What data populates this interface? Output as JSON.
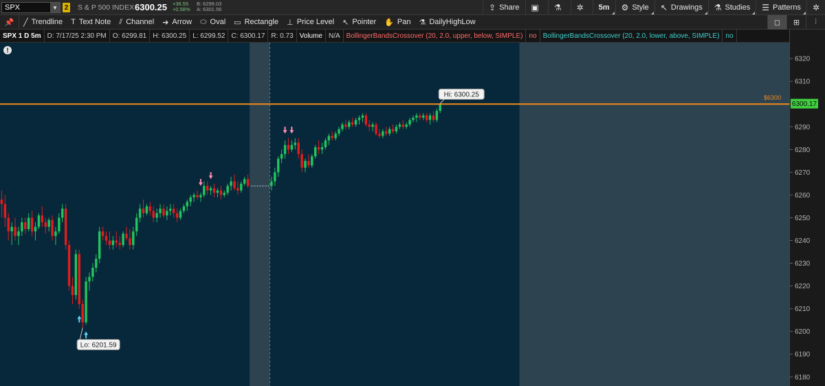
{
  "header": {
    "symbol": "SPX",
    "link_badge": "2",
    "index_name": "S & P 500 INDEX",
    "last_price": "6300.25",
    "change": "+36.55",
    "change_pct": "+0.58%",
    "bid": "B: 6299.03",
    "ask": "A: 6301.56",
    "buttons": {
      "share": "Share",
      "timeframe": "5m",
      "style": "Style",
      "drawings": "Drawings",
      "studies": "Studies",
      "patterns": "Patterns"
    }
  },
  "drawing_tools": [
    {
      "label": "Trendline",
      "icon": "trendline-icon",
      "glyph": "╱"
    },
    {
      "label": "Text Note",
      "icon": "text-note-icon",
      "glyph": "T"
    },
    {
      "label": "Channel",
      "icon": "channel-icon",
      "glyph": "⫽"
    },
    {
      "label": "Arrow",
      "icon": "arrow-icon",
      "glyph": "➜"
    },
    {
      "label": "Oval",
      "icon": "oval-icon",
      "glyph": "⬭"
    },
    {
      "label": "Rectangle",
      "icon": "rectangle-icon",
      "glyph": "▭"
    },
    {
      "label": "Price Level",
      "icon": "price-level-icon",
      "glyph": "⊥"
    },
    {
      "label": "Pointer",
      "icon": "pointer-icon",
      "glyph": "↖"
    },
    {
      "label": "Pan",
      "icon": "pan-icon",
      "glyph": "✋"
    },
    {
      "label": "DailyHighLow",
      "icon": "flask-icon",
      "glyph": "⚗"
    }
  ],
  "info_bar": {
    "title": "SPX 1 D 5m",
    "date": "D: 7/17/25 2:30 PM",
    "open": "O: 6299.81",
    "high": "H: 6300.25",
    "low": "L: 6299.52",
    "close": "C: 6300.17",
    "range": "R: 0.73",
    "volume_label": "Volume",
    "volume_value": "N/A",
    "study1": "BollingerBandsCrossover (20, 2.0, upper, below, SIMPLE)",
    "study1_value": "no",
    "study2": "BollingerBandsCrossover (20, 2.0, lower, above, SIMPLE)",
    "study2_value": "no"
  },
  "colors": {
    "up": "#22c55e",
    "down": "#e21d1d",
    "price_line": "#f28a1a",
    "background_main": "#07273a",
    "background_extended": "#2d4350",
    "current_price_tag": "#3fcf3f",
    "buy_signal": "#5ad2f0",
    "sell_signal": "#ff8fb0"
  },
  "chart_data": {
    "type": "candlestick",
    "symbol": "SPX",
    "interval": "5m",
    "ylim": [
      6176,
      6327
    ],
    "y_ticks": [
      6180,
      6190,
      6200,
      6210,
      6220,
      6230,
      6240,
      6250,
      6260,
      6270,
      6280,
      6290,
      6300,
      6310,
      6320
    ],
    "price_line": {
      "value": 6300,
      "label": "$6300"
    },
    "current_price": "6300.17",
    "high_marker": {
      "label": "Hi: 6300.25",
      "value": 6300.25
    },
    "low_marker": {
      "label": "Lo: 6201.59",
      "value": 6201.59
    },
    "sessions": [
      {
        "name": "regular",
        "start_bar": 0,
        "end_bar": 74
      },
      {
        "name": "extended",
        "start_bar": 74,
        "end_bar": 80
      },
      {
        "name": "regular",
        "start_bar": 80,
        "end_bar": 154
      },
      {
        "name": "extended",
        "start_bar": 154,
        "end_bar": 234
      }
    ],
    "day_separator_bar": 80,
    "total_bars": 234,
    "candles": [
      [
        0,
        6258,
        6262,
        6250,
        6256
      ],
      [
        1,
        6256,
        6260,
        6246,
        6250
      ],
      [
        2,
        6250,
        6252,
        6240,
        6244
      ],
      [
        3,
        6244,
        6248,
        6238,
        6246
      ],
      [
        4,
        6246,
        6250,
        6240,
        6242
      ],
      [
        5,
        6242,
        6246,
        6238,
        6244
      ],
      [
        6,
        6244,
        6250,
        6242,
        6248
      ],
      [
        7,
        6248,
        6250,
        6243,
        6245
      ],
      [
        8,
        6245,
        6252,
        6244,
        6250
      ],
      [
        9,
        6250,
        6253,
        6242,
        6244
      ],
      [
        10,
        6244,
        6248,
        6240,
        6246
      ],
      [
        11,
        6246,
        6252,
        6245,
        6251
      ],
      [
        12,
        6251,
        6255,
        6246,
        6248
      ],
      [
        13,
        6248,
        6250,
        6243,
        6246
      ],
      [
        14,
        6246,
        6250,
        6244,
        6249
      ],
      [
        15,
        6249,
        6251,
        6240,
        6242
      ],
      [
        16,
        6242,
        6246,
        6238,
        6244
      ],
      [
        17,
        6244,
        6252,
        6243,
        6250
      ],
      [
        18,
        6250,
        6256,
        6248,
        6254
      ],
      [
        19,
        6254,
        6256,
        6236,
        6238
      ],
      [
        20,
        6238,
        6240,
        6218,
        6220
      ],
      [
        21,
        6220,
        6224,
        6212,
        6216
      ],
      [
        22,
        6216,
        6236,
        6214,
        6234
      ],
      [
        23,
        6234,
        6236,
        6210,
        6212
      ],
      [
        24,
        6212,
        6214,
        6201.59,
        6204
      ],
      [
        25,
        6204,
        6224,
        6203,
        6222
      ],
      [
        26,
        6222,
        6226,
        6218,
        6224
      ],
      [
        27,
        6224,
        6230,
        6222,
        6228
      ],
      [
        28,
        6228,
        6234,
        6226,
        6232
      ],
      [
        29,
        6232,
        6246,
        6230,
        6244
      ],
      [
        30,
        6244,
        6246,
        6240,
        6242
      ],
      [
        31,
        6242,
        6244,
        6238,
        6240
      ],
      [
        32,
        6240,
        6244,
        6236,
        6238
      ],
      [
        33,
        6238,
        6242,
        6236,
        6240
      ],
      [
        34,
        6240,
        6244,
        6237,
        6239
      ],
      [
        35,
        6239,
        6242,
        6236,
        6238
      ],
      [
        36,
        6238,
        6244,
        6237,
        6243
      ],
      [
        37,
        6243,
        6246,
        6240,
        6241
      ],
      [
        38,
        6241,
        6245,
        6236,
        6238
      ],
      [
        39,
        6238,
        6246,
        6236,
        6244
      ],
      [
        40,
        6244,
        6252,
        6242,
        6250
      ],
      [
        41,
        6250,
        6256,
        6248,
        6254
      ],
      [
        42,
        6254,
        6258,
        6250,
        6252
      ],
      [
        43,
        6252,
        6256,
        6251,
        6255
      ],
      [
        44,
        6255,
        6257,
        6251,
        6253
      ],
      [
        45,
        6253,
        6255,
        6248,
        6250
      ],
      [
        46,
        6250,
        6254,
        6248,
        6252
      ],
      [
        47,
        6252,
        6256,
        6250,
        6254
      ],
      [
        48,
        6254,
        6256,
        6250,
        6251
      ],
      [
        49,
        6251,
        6255,
        6249,
        6253
      ],
      [
        50,
        6253,
        6256,
        6251,
        6254
      ],
      [
        51,
        6254,
        6256,
        6250,
        6252
      ],
      [
        52,
        6252,
        6254,
        6248,
        6250
      ],
      [
        53,
        6250,
        6254,
        6249,
        6253
      ],
      [
        54,
        6253,
        6256,
        6252,
        6255
      ],
      [
        55,
        6255,
        6258,
        6253,
        6257
      ],
      [
        56,
        6257,
        6260,
        6255,
        6259
      ],
      [
        57,
        6259,
        6261,
        6257,
        6260
      ],
      [
        58,
        6260,
        6262,
        6258,
        6259
      ],
      [
        59,
        6259,
        6261,
        6257,
        6260
      ],
      [
        60,
        6260,
        6266,
        6259,
        6264
      ],
      [
        61,
        6264,
        6266,
        6260,
        6262
      ],
      [
        62,
        6262,
        6264,
        6260,
        6263
      ],
      [
        63,
        6263,
        6265,
        6259,
        6261
      ],
      [
        64,
        6261,
        6263,
        6259,
        6262
      ],
      [
        65,
        6262,
        6264,
        6258,
        6260
      ],
      [
        66,
        6260,
        6262,
        6259,
        6261
      ],
      [
        67,
        6261,
        6265,
        6260,
        6264
      ],
      [
        68,
        6264,
        6268,
        6262,
        6266
      ],
      [
        69,
        6266,
        6269,
        6262,
        6263
      ],
      [
        70,
        6263,
        6266,
        6260,
        6262
      ],
      [
        71,
        6262,
        6266,
        6261,
        6265
      ],
      [
        72,
        6265,
        6268,
        6264,
        6267
      ],
      [
        73,
        6267,
        6269,
        6263,
        6264
      ],
      [
        80,
        6264,
        6268,
        6262,
        6266
      ],
      [
        81,
        6266,
        6272,
        6264,
        6270
      ],
      [
        82,
        6270,
        6277,
        6268,
        6276
      ],
      [
        83,
        6276,
        6280,
        6274,
        6278
      ],
      [
        84,
        6278,
        6284,
        6276,
        6282
      ],
      [
        85,
        6282,
        6285,
        6278,
        6280
      ],
      [
        86,
        6280,
        6284,
        6279,
        6282
      ],
      [
        87,
        6282,
        6285,
        6280,
        6283
      ],
      [
        88,
        6283,
        6285,
        6276,
        6278
      ],
      [
        89,
        6278,
        6280,
        6270,
        6272
      ],
      [
        90,
        6272,
        6276,
        6270,
        6275
      ],
      [
        91,
        6275,
        6278,
        6272,
        6273
      ],
      [
        92,
        6273,
        6278,
        6272,
        6277
      ],
      [
        93,
        6277,
        6282,
        6276,
        6281
      ],
      [
        94,
        6281,
        6284,
        6278,
        6280
      ],
      [
        95,
        6280,
        6283,
        6278,
        6281
      ],
      [
        96,
        6281,
        6285,
        6280,
        6284
      ],
      [
        97,
        6284,
        6287,
        6282,
        6286
      ],
      [
        98,
        6286,
        6288,
        6284,
        6285
      ],
      [
        99,
        6285,
        6288,
        6284,
        6287
      ],
      [
        100,
        6287,
        6290,
        6286,
        6289
      ],
      [
        101,
        6289,
        6292,
        6288,
        6291
      ],
      [
        102,
        6291,
        6293,
        6289,
        6290
      ],
      [
        103,
        6290,
        6293,
        6289,
        6292
      ],
      [
        104,
        6292,
        6294,
        6290,
        6291
      ],
      [
        105,
        6291,
        6294,
        6290,
        6293
      ],
      [
        106,
        6293,
        6295,
        6291,
        6294
      ],
      [
        107,
        6294,
        6296,
        6292,
        6295
      ],
      [
        108,
        6295,
        6296,
        6290,
        6291
      ],
      [
        109,
        6291,
        6293,
        6288,
        6290
      ],
      [
        110,
        6290,
        6292,
        6288,
        6291
      ],
      [
        111,
        6291,
        6292,
        6286,
        6287
      ],
      [
        112,
        6287,
        6289,
        6285,
        6286
      ],
      [
        113,
        6286,
        6289,
        6285,
        6288
      ],
      [
        114,
        6288,
        6290,
        6286,
        6287
      ],
      [
        115,
        6287,
        6290,
        6286,
        6289
      ],
      [
        116,
        6289,
        6291,
        6287,
        6288
      ],
      [
        117,
        6288,
        6291,
        6287,
        6290
      ],
      [
        118,
        6290,
        6292,
        6289,
        6291
      ],
      [
        119,
        6291,
        6293,
        6289,
        6290
      ],
      [
        120,
        6290,
        6292,
        6289,
        6291
      ],
      [
        121,
        6291,
        6294,
        6290,
        6293
      ],
      [
        122,
        6293,
        6295,
        6292,
        6294
      ],
      [
        123,
        6294,
        6296,
        6292,
        6295
      ],
      [
        124,
        6295,
        6296,
        6293,
        6294
      ],
      [
        125,
        6294,
        6296,
        6293,
        6295
      ],
      [
        126,
        6295,
        6296,
        6292,
        6293
      ],
      [
        127,
        6293,
        6296,
        6291,
        6295
      ],
      [
        128,
        6295,
        6297,
        6292,
        6293
      ],
      [
        129,
        6293,
        6298,
        6292,
        6297
      ],
      [
        130,
        6297,
        6300.25,
        6296,
        6300.17
      ]
    ],
    "signals": [
      {
        "bar": 23,
        "type": "buy"
      },
      {
        "bar": 25,
        "type": "buy"
      },
      {
        "bar": 59,
        "type": "sell"
      },
      {
        "bar": 62,
        "type": "sell"
      },
      {
        "bar": 84,
        "type": "sell"
      },
      {
        "bar": 86,
        "type": "sell"
      }
    ]
  }
}
